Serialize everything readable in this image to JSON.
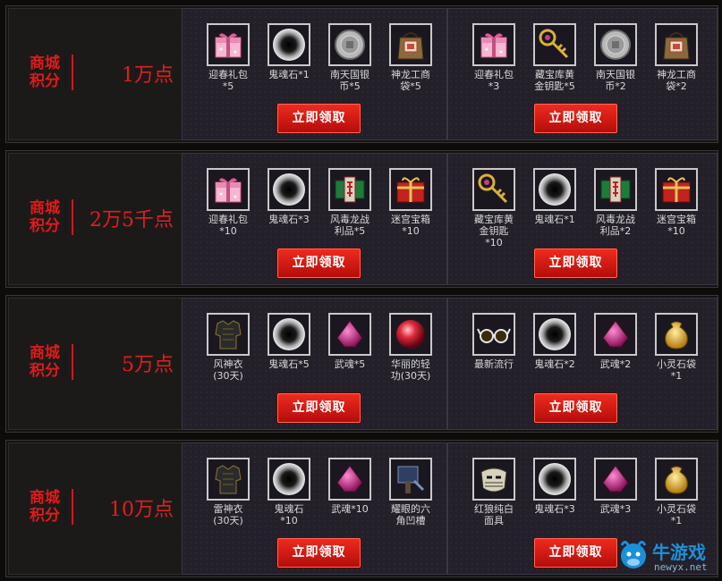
{
  "tiers": [
    {
      "label": "商城\n积分",
      "points": "1万点",
      "packs": [
        {
          "button": "立即领取",
          "items": [
            {
              "name": "迎春礼包\n*5",
              "icon": "gift-box-icon"
            },
            {
              "name": "鬼魂石*1",
              "icon": "ghost-stone-icon"
            },
            {
              "name": "南天国银\n币*5",
              "icon": "silver-coin-icon"
            },
            {
              "name": "神龙工商\n袋*5",
              "icon": "bag-icon"
            }
          ]
        },
        {
          "button": "立即领取",
          "items": [
            {
              "name": "迎春礼包\n*3",
              "icon": "gift-box-icon"
            },
            {
              "name": "藏宝库黄\n金钥匙*5",
              "icon": "gold-key-icon"
            },
            {
              "name": "南天国银\n币*2",
              "icon": "silver-coin-icon"
            },
            {
              "name": "神龙工商\n袋*2",
              "icon": "bag-icon"
            }
          ]
        }
      ]
    },
    {
      "label": "商城\n积分",
      "points": "2万5千点",
      "packs": [
        {
          "button": "立即领取",
          "items": [
            {
              "name": "迎春礼包\n*10",
              "icon": "gift-box-icon"
            },
            {
              "name": "鬼魂石*3",
              "icon": "ghost-stone-icon"
            },
            {
              "name": "风毒龙战\n利品*5",
              "icon": "loot-scroll-icon"
            },
            {
              "name": "迷宫宝箱\n*10",
              "icon": "treasure-box-icon"
            }
          ]
        },
        {
          "button": "立即领取",
          "items": [
            {
              "name": "藏宝库黄\n金钥匙\n*10",
              "icon": "gold-key-icon"
            },
            {
              "name": "鬼魂石*1",
              "icon": "ghost-stone-icon"
            },
            {
              "name": "风毒龙战\n利品*2",
              "icon": "loot-scroll-icon"
            },
            {
              "name": "迷宫宝箱\n*10",
              "icon": "treasure-box-icon"
            }
          ]
        }
      ]
    },
    {
      "label": "商城\n积分",
      "points": "5万点",
      "packs": [
        {
          "button": "立即领取",
          "items": [
            {
              "name": "风神衣\n(30天)",
              "icon": "armor-icon"
            },
            {
              "name": "鬼魂石*5",
              "icon": "ghost-stone-icon"
            },
            {
              "name": "武魂*5",
              "icon": "pink-gem-icon"
            },
            {
              "name": "华丽的轻\n功(30天)",
              "icon": "red-orb-icon"
            }
          ]
        },
        {
          "button": "立即领取",
          "items": [
            {
              "name": "最新流行",
              "icon": "glasses-icon"
            },
            {
              "name": "鬼魂石*2",
              "icon": "ghost-stone-icon"
            },
            {
              "name": "武魂*2",
              "icon": "pink-gem-icon"
            },
            {
              "name": "小灵石袋\n*1",
              "icon": "gold-pouch-icon"
            }
          ]
        }
      ]
    },
    {
      "label": "商城\n积分",
      "points": "10万点",
      "packs": [
        {
          "button": "立即领取",
          "items": [
            {
              "name": "雷神衣\n(30天)",
              "icon": "armor-icon"
            },
            {
              "name": "鬼魂石\n*10",
              "icon": "ghost-stone-icon"
            },
            {
              "name": "武魂*10",
              "icon": "pink-gem-icon"
            },
            {
              "name": "耀眼的六\n角凹槽",
              "icon": "hex-socket-icon"
            }
          ]
        },
        {
          "button": "立即领取",
          "items": [
            {
              "name": "红狼纯白\n面具",
              "icon": "mask-icon"
            },
            {
              "name": "鬼魂石*3",
              "icon": "ghost-stone-icon"
            },
            {
              "name": "武魂*3",
              "icon": "pink-gem-icon"
            },
            {
              "name": "小灵石袋\n*1",
              "icon": "gold-pouch-icon"
            }
          ]
        }
      ]
    }
  ],
  "watermark": {
    "brand": "牛游戏",
    "url": "newyx.net"
  }
}
